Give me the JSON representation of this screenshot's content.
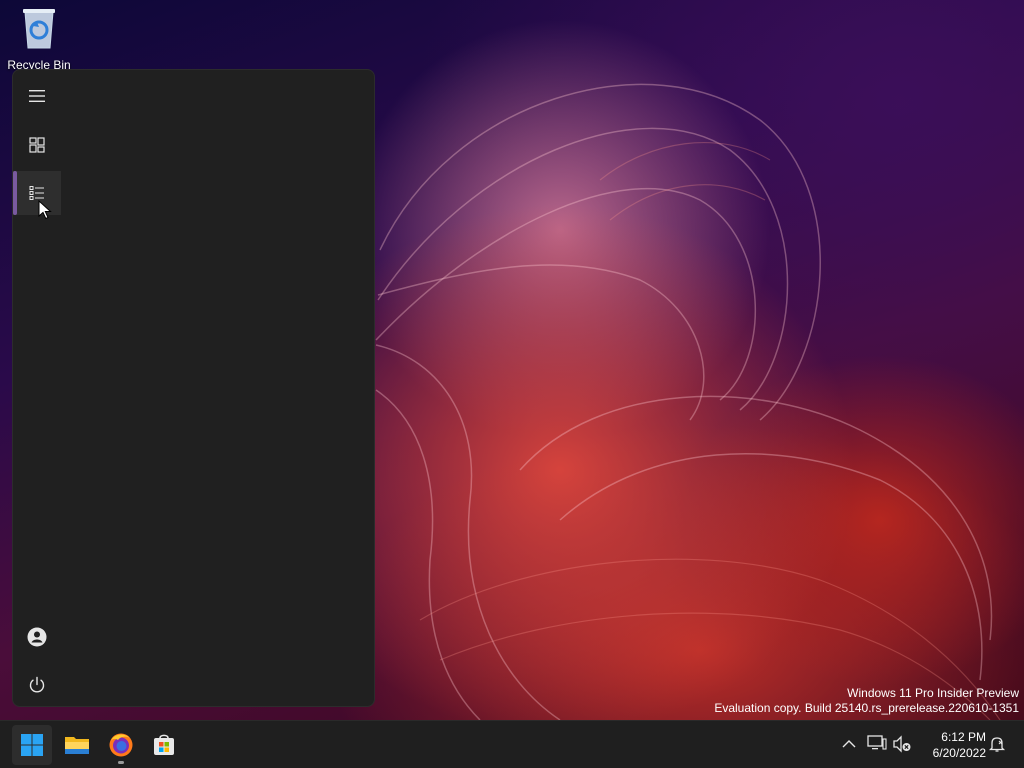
{
  "desktop": {
    "recycle_bin_label": "Recycle Bin"
  },
  "watermark": {
    "line1": "Windows 11 Pro Insider Preview",
    "line2": "Evaluation copy. Build 25140.rs_prerelease.220610-1351"
  },
  "start_menu": {
    "rail": [
      {
        "icon": "hamburger-menu-icon"
      },
      {
        "icon": "grid-tiles-icon"
      },
      {
        "icon": "list-view-icon",
        "active": true
      },
      {
        "icon": "user-account-icon"
      },
      {
        "icon": "power-icon"
      }
    ],
    "accent_color": "#7a5aa0"
  },
  "taskbar": {
    "apps": [
      {
        "icon": "windows-start-icon"
      },
      {
        "icon": "file-explorer-icon"
      },
      {
        "icon": "firefox-icon",
        "running": true
      },
      {
        "icon": "microsoft-store-icon"
      }
    ],
    "tray": [
      {
        "icon": "chevron-up-icon"
      },
      {
        "icon": "network-icon"
      },
      {
        "icon": "volume-muted-icon"
      },
      {
        "icon": "notification-icon"
      }
    ],
    "time": "6:12 PM",
    "date": "6/20/2022"
  }
}
